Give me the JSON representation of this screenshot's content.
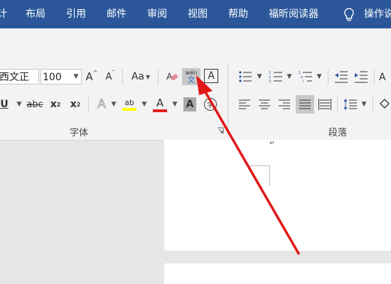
{
  "tabs": [
    {
      "label": "计"
    },
    {
      "label": "布局"
    },
    {
      "label": "引用"
    },
    {
      "label": "邮件"
    },
    {
      "label": "审阅"
    },
    {
      "label": "视图"
    },
    {
      "label": "帮助"
    },
    {
      "label": "福昕阅读器"
    },
    {
      "label": "操作说"
    }
  ],
  "tell_me_icon": "lightbulb-icon",
  "font": {
    "name_value": "西文正",
    "size_value": "100",
    "grow_label": "A",
    "shrink_label": "A",
    "change_case_label": "Aa",
    "phonetic_top": "wén",
    "phonetic_bottom": "文",
    "char_border_label": "A",
    "underline_label": "U",
    "strike_label": "abc",
    "subscript_label": "x",
    "subscript_mark": "2",
    "superscript_label": "x",
    "superscript_mark": "2",
    "effects_label": "A",
    "highlight_label": "ab",
    "font_color_label": "A",
    "shading_label": "A",
    "enclose_label": "字",
    "group_label": "字体",
    "highlight_color": "#ffff00",
    "font_color": "#e02020"
  },
  "paragraph": {
    "group_label": "段落"
  },
  "document": {
    "paragraph_mark": "↵"
  },
  "annotation_arrow_color": "#e01818"
}
